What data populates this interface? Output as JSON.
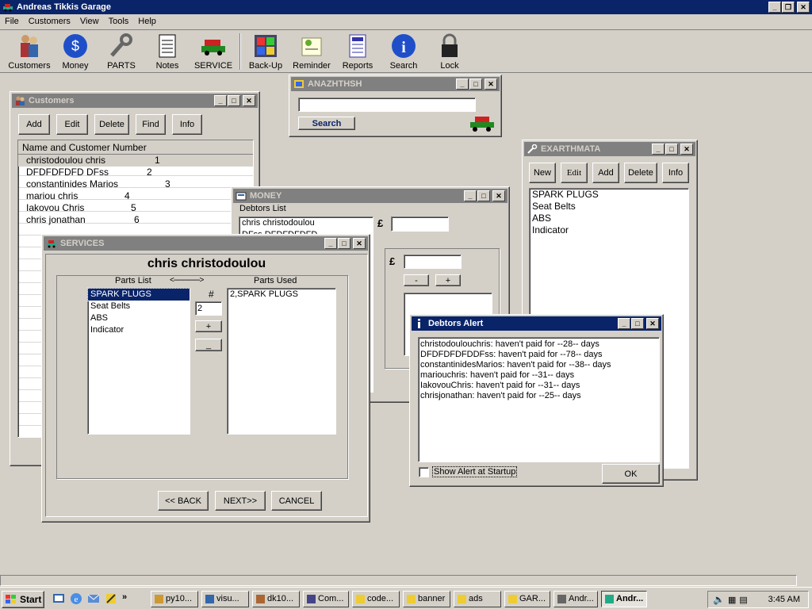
{
  "app": {
    "title": "Andreas Tikkis Garage"
  },
  "menu": [
    "File",
    "Customers",
    "View",
    "Tools",
    "Help"
  ],
  "toolbar": [
    {
      "label": "Customers",
      "icon": "people-icon"
    },
    {
      "label": "Money",
      "icon": "dollar-icon"
    },
    {
      "label": "PARTS",
      "icon": "wrench-icon"
    },
    {
      "label": "Notes",
      "icon": "notepad-icon"
    },
    {
      "label": "SERVICE",
      "icon": "cars-icon"
    },
    {
      "label": "Back-Up",
      "icon": "backup-icon"
    },
    {
      "label": "Reminder",
      "icon": "reminder-icon"
    },
    {
      "label": "Reports",
      "icon": "reports-icon"
    },
    {
      "label": "Search",
      "icon": "info-icon"
    },
    {
      "label": "Lock",
      "icon": "padlock-icon"
    }
  ],
  "customers": {
    "title": "Customers",
    "buttons": [
      "Add",
      "Edit",
      "Delete",
      "Find",
      "Info"
    ],
    "header": "Name and Customer Number",
    "rows": [
      {
        "name": "christodoulou chris",
        "num": "1"
      },
      {
        "name": "DFDFDFDFD DFss",
        "num": "2"
      },
      {
        "name": "constantinides Marios",
        "num": "3"
      },
      {
        "name": "mariou chris",
        "num": "4"
      },
      {
        "name": "Iakovou Chris",
        "num": "5"
      },
      {
        "name": "chris jonathan",
        "num": "6"
      }
    ]
  },
  "search": {
    "title": "ANAZHTHSH",
    "button": "Search",
    "value": ""
  },
  "parts": {
    "title": "EXARTHMATA",
    "buttons": [
      "New",
      "Edit",
      "Add",
      "Delete",
      "Info"
    ],
    "items": [
      "SPARK PLUGS",
      "Seat Belts",
      "ABS",
      "Indicator"
    ]
  },
  "money": {
    "title": "MONEY",
    "debtors_label": "Debtors List",
    "debtors": [
      "chris christodoulou",
      "DFss DFDFDFDFD"
    ],
    "currency": "£",
    "minus": "-",
    "plus": "+"
  },
  "services": {
    "title": "SERVICES",
    "customer": "chris christodoulou",
    "parts_label": "Parts List",
    "arrow": "<-------------->",
    "used_label": "Parts Used",
    "hash": "#",
    "qty": "2",
    "plus": "+",
    "minus": "_",
    "parts": [
      "SPARK PLUGS",
      "Seat Belts",
      "ABS",
      "Indicator"
    ],
    "used": [
      "2,SPARK PLUGS"
    ],
    "back": "<< BACK",
    "next": "NEXT>>",
    "cancel": "CANCEL"
  },
  "alert": {
    "title": "Debtors Alert",
    "lines": [
      "christodoulouchris: haven't paid for --28-- days",
      "DFDFDFDFDDFss: haven't paid for --78-- days",
      "constantinidesMarios: haven't paid for --38-- days",
      "mariouchris: haven't paid for --31-- days",
      "IakovouChris: haven't paid for --31-- days",
      "chrisjonathan: haven't paid for --25-- days"
    ],
    "checkbox": "Show Alert at Startup",
    "ok": "OK"
  },
  "taskbar": {
    "start": "Start",
    "tasks": [
      "py10...",
      "visu...",
      "dk10...",
      "Com...",
      "code...",
      "banner",
      "ads",
      "GAR...",
      "Andr...",
      "Andr..."
    ],
    "clock": "3:45 AM"
  }
}
